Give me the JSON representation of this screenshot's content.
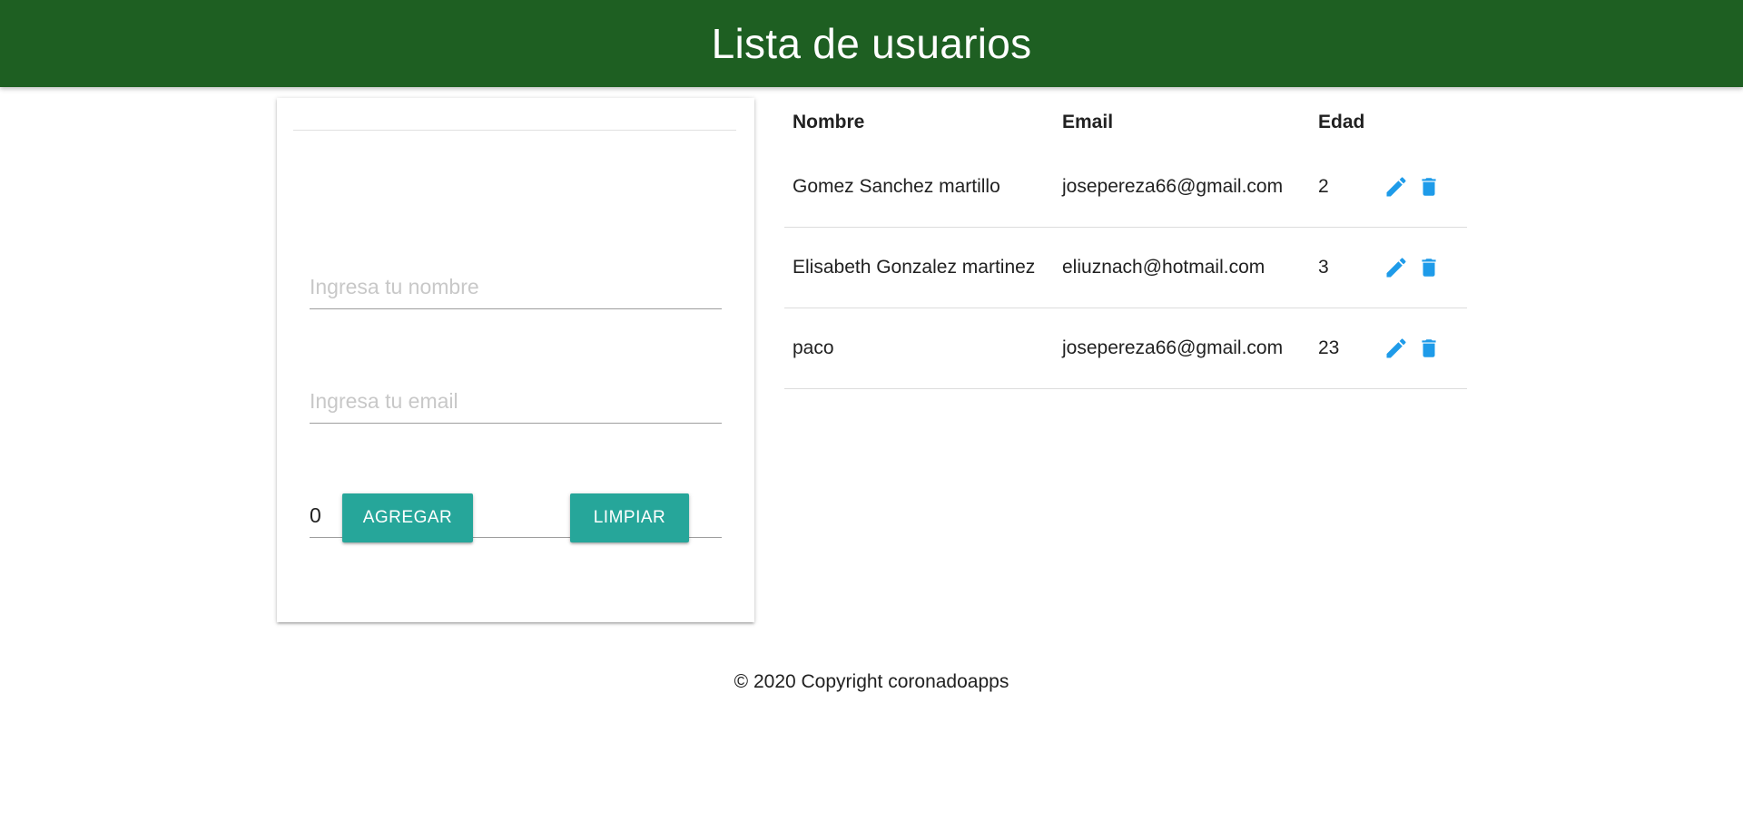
{
  "header": {
    "title": "Lista de usuarios"
  },
  "form": {
    "name_placeholder": "Ingresa tu nombre",
    "email_placeholder": "Ingresa tu email",
    "age_value": "0",
    "add_label": "AGREGAR",
    "clear_label": "LIMPIAR"
  },
  "table": {
    "headers": {
      "name": "Nombre",
      "email": "Email",
      "age": "Edad"
    },
    "rows": [
      {
        "name": "Gomez Sanchez martillo",
        "email": "josepereza66@gmail.com",
        "age": "2"
      },
      {
        "name": "Elisabeth Gonzalez martinez",
        "email": "eliuznach@hotmail.com",
        "age": "3"
      },
      {
        "name": "paco",
        "email": "josepereza66@gmail.com",
        "age": "23"
      }
    ],
    "icons": {
      "edit": "pencil-icon",
      "delete": "trash-icon"
    }
  },
  "footer": {
    "text": "© 2020 Copyright coronadoapps"
  },
  "colors": {
    "header_bg": "#1e5f22",
    "button_bg": "#26a69a",
    "icon_color": "#1e9be9"
  }
}
